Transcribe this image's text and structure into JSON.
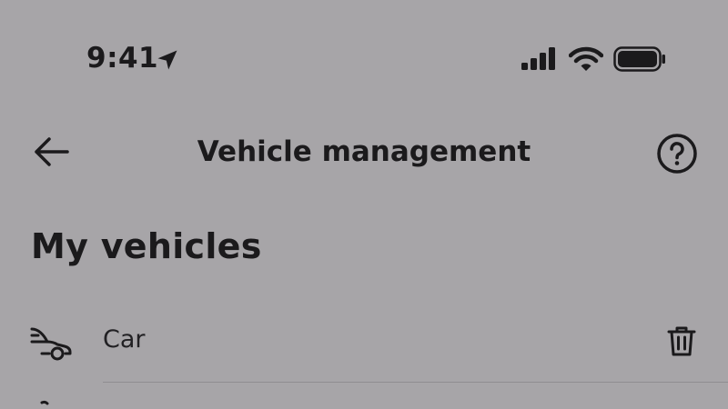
{
  "status_bar": {
    "time": "9:41",
    "icons": [
      "location-arrow-icon",
      "cellular-signal-icon",
      "wifi-icon",
      "battery-icon"
    ]
  },
  "nav": {
    "title": "Vehicle management",
    "back_icon": "arrow-left-icon",
    "help_icon": "question-circle-icon"
  },
  "section": {
    "title": "My vehicles"
  },
  "vehicles": [
    {
      "label": "Car",
      "icon": "car-icon",
      "action_icon": "trash-icon"
    }
  ],
  "colors": {
    "background": "#a7a5a8",
    "text": "#1b1a1c",
    "divider": "#8f8d91"
  }
}
